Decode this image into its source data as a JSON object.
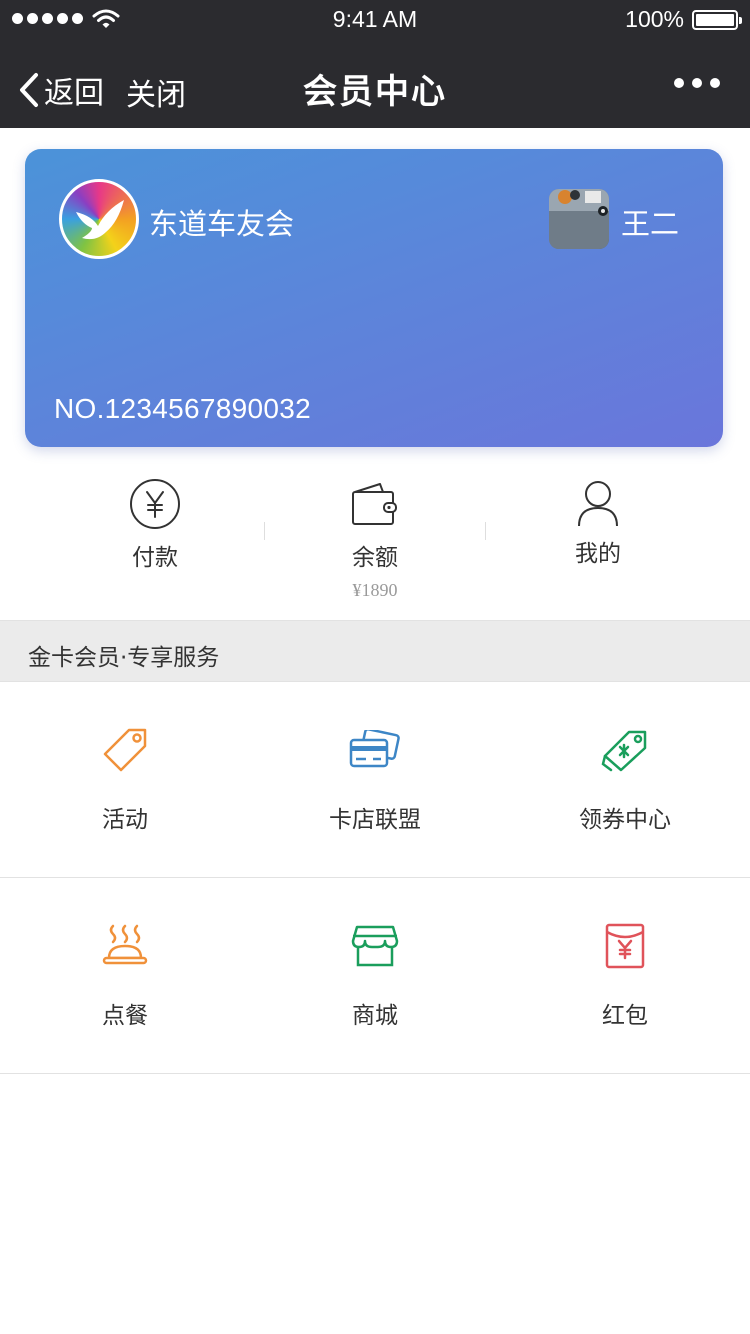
{
  "status_bar": {
    "time": "9:41 AM",
    "battery": "100%"
  },
  "nav": {
    "back_label": "返回",
    "close_label": "关闭",
    "title": "会员中心"
  },
  "card": {
    "club_name": "东道车友会",
    "user_name": "王二",
    "number": "NO.1234567890032"
  },
  "quick_actions": [
    {
      "label": "付款",
      "icon": "yuan-circle-icon"
    },
    {
      "label": "余额",
      "icon": "wallet-icon",
      "value": "¥1890"
    },
    {
      "label": "我的",
      "icon": "user-icon"
    }
  ],
  "section_title": "金卡会员·专享服务",
  "services": [
    {
      "label": "活动",
      "icon": "tag-icon",
      "color": "#f0913a"
    },
    {
      "label": "卡店联盟",
      "icon": "cards-icon",
      "color": "#3d86c6"
    },
    {
      "label": "领券中心",
      "icon": "coupon-icon",
      "color": "#1a9e5c"
    },
    {
      "label": "点餐",
      "icon": "food-cloche-icon",
      "color": "#f0913a"
    },
    {
      "label": "商城",
      "icon": "store-icon",
      "color": "#1a9e5c"
    },
    {
      "label": "红包",
      "icon": "red-packet-icon",
      "color": "#e0535a"
    }
  ]
}
